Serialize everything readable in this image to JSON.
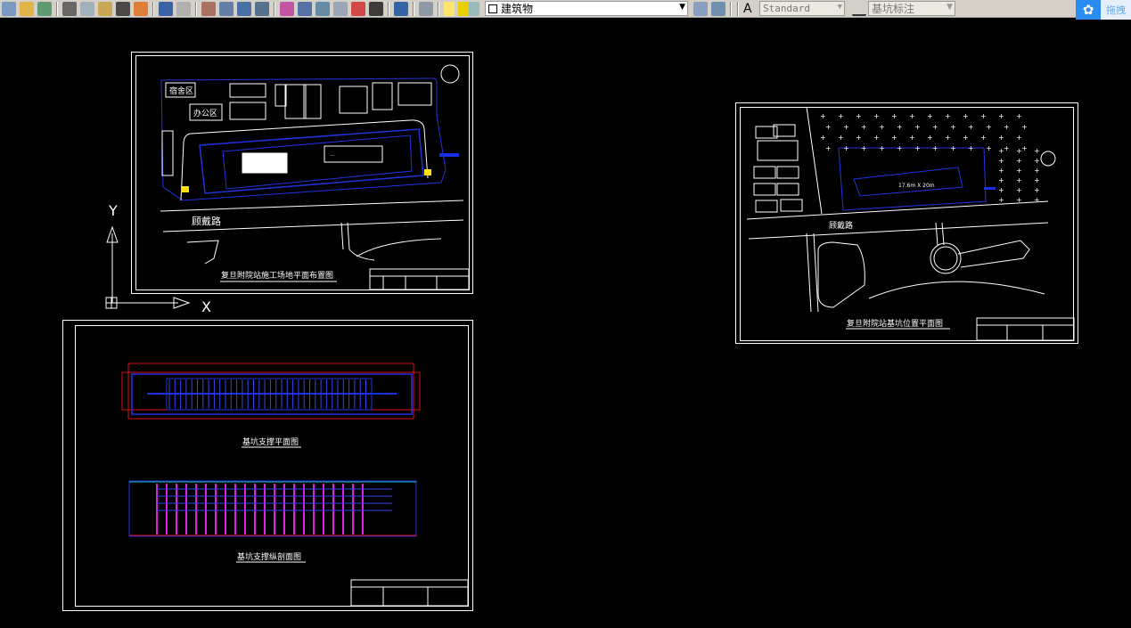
{
  "toolbar": {
    "icons": [
      "qnew-icon",
      "open-icon",
      "publish-icon",
      "cut-icon",
      "copy-icon",
      "paste-icon",
      "match-properties-icon",
      "block-editor-icon",
      "undo-icon",
      "redo-icon",
      "pan-icon",
      "zoom-realtime-icon",
      "zoom-window-icon",
      "zoom-previous-icon",
      "properties-icon",
      "design-center-icon",
      "tool-palettes-icon",
      "sheet-set-icon",
      "markup-icon",
      "calculator-icon",
      "help-icon",
      "layer-manager-icon"
    ],
    "layer_combo": {
      "value": "建筑物",
      "icons": [
        "lightbulb-icon",
        "sun-icon",
        "lock-icon",
        "color-square-icon"
      ]
    },
    "text_style": {
      "value": "Standard"
    },
    "dim_style": {
      "value": "基坑标注"
    },
    "cloud_button": {
      "label": "拖拽",
      "color": "#2a8cf0"
    }
  },
  "ucs": {
    "x_label": "X",
    "y_label": "Y"
  },
  "drawings": [
    {
      "title": "复旦附院站施工场地平面布置图",
      "road": "顾戴路",
      "zones": [
        "宿舍区",
        "办公区"
      ]
    },
    {
      "title": "复旦附院站基坑位置平面图",
      "road": "顾戴路",
      "dimension": "17.6m X 20m"
    },
    {
      "plan_title": "基坑支撑平面图",
      "section_title": "基坑支撑纵剖面图"
    }
  ],
  "colors": {
    "canvas": "#000000",
    "line": "#ffffff",
    "pit": "#1a2ee6",
    "dimension": "#e01010",
    "pile": "#e020e0"
  }
}
